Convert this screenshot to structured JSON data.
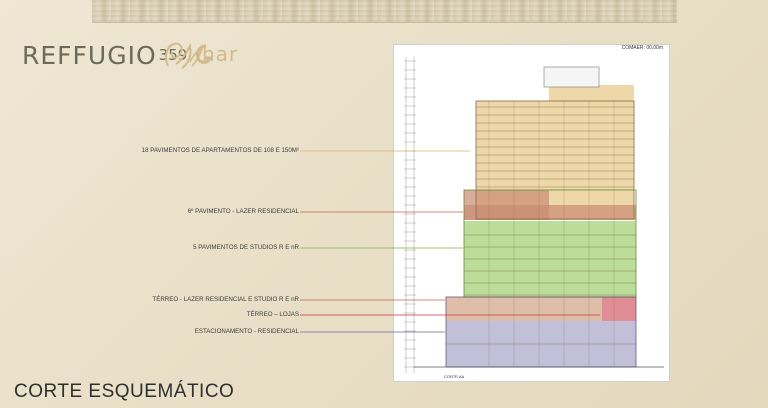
{
  "brand": {
    "name": "REFFUGIO",
    "number": "359",
    "partner": "har"
  },
  "drawing": {
    "scale_note": "COMAER: 00,00m",
    "bottom_note": "CORTE AA"
  },
  "sections": [
    {
      "label": "18 PAVIMENTOS DE APARTAMENTOS DE 108 E 150M²",
      "color": "#d9b36a"
    },
    {
      "label": "6º PAVIMENTO - LAZER RESIDENCIAL",
      "color": "#c0604a"
    },
    {
      "label": "5 PAVIMENTOS DE STUDIOS R E nR",
      "color": "#7fb63a"
    },
    {
      "label": "TÉRREO - LAZER RESIDENCIAL E STUDIO R E nR",
      "color": "#c0604a"
    },
    {
      "label": "TÉRREO – LOJAS",
      "color": "#c8323c"
    },
    {
      "label": "ESTACIONAMENTO - RESIDENCIAL",
      "color": "#6e6a9c"
    }
  ],
  "footer": {
    "title": "CORTE ESQUEMÁTICO"
  }
}
